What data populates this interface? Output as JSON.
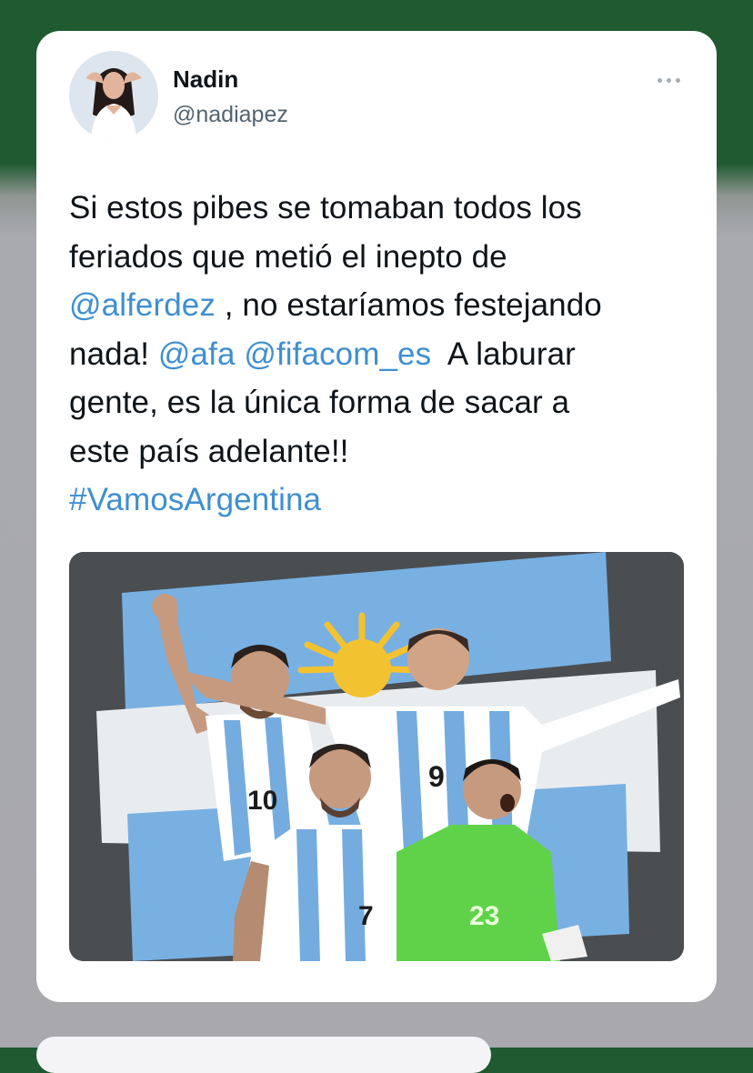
{
  "tweet": {
    "author_name": "Nadin",
    "author_handle": "@nadiapez",
    "text_line1": "Si estos pibes se tomaban todos los",
    "text_line2": "feriados que metió el inepto de",
    "mention1": "@alferdez",
    "text_line3_rest": " , no estaríamos festejando",
    "text_line4_start": "nada! ",
    "mention2": "@afa",
    "mention3": "@fifacom_es",
    "text_line4_end": "  A laburar",
    "text_line5": "gente, es la única forma de sacar a",
    "text_line6": "este país adelante!!",
    "hashtag": "#VamosArgentina",
    "player_numbers": [
      "10",
      "9",
      "7",
      "23"
    ]
  },
  "icons": {
    "more": "more-horizontal-icon"
  },
  "colors": {
    "link": "#3f8fd0",
    "top_band": "#1f5a31",
    "argentina_blue": "#74acdf",
    "goalkeeper_green": "#5fd24a"
  }
}
